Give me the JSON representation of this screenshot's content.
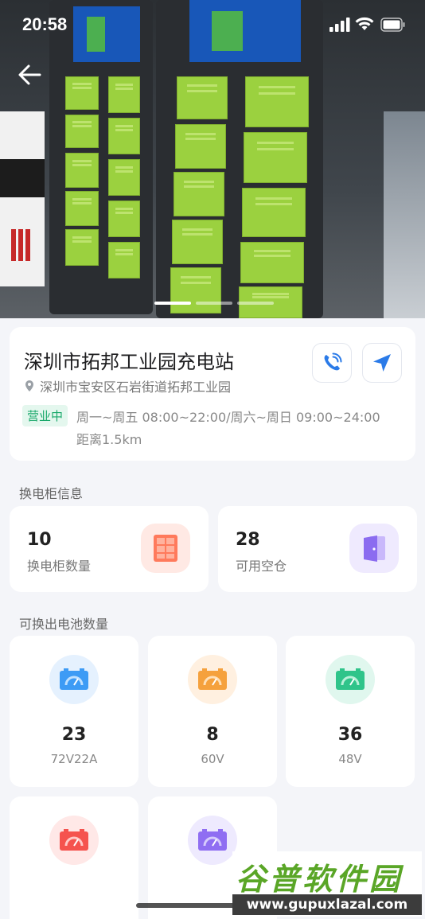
{
  "status_bar": {
    "time": "20:58"
  },
  "station": {
    "name": "深圳市拓邦工业园充电站",
    "address": "深圳市宝安区石岩街道拓邦工业园",
    "status_badge": "营业中",
    "hours": "周一~周五 08:00~22:00/周六~周日 09:00~24:00",
    "distance": "距离1.5km"
  },
  "icons": {
    "back": "back-arrow-icon",
    "call": "phone-call-icon",
    "navigate": "navigation-arrow-icon",
    "location": "location-pin-icon",
    "cabinet": "cabinet-icon",
    "door": "door-icon",
    "battery": "battery-gauge-icon"
  },
  "cabinet_section": {
    "title": "换电柜信息",
    "items": [
      {
        "value": "10",
        "label": "换电柜数量",
        "color": "#ff7a5c"
      },
      {
        "value": "28",
        "label": "可用空仓",
        "color": "#8b6cf0"
      }
    ]
  },
  "battery_section": {
    "title": "可换出电池数量",
    "items": [
      {
        "value": "23",
        "label": "72V22A",
        "color": "#3d9bf5"
      },
      {
        "value": "8",
        "label": "60V",
        "color": "#f5a13d"
      },
      {
        "value": "36",
        "label": "48V",
        "color": "#2fc48a"
      },
      {
        "value": "",
        "label": "",
        "color": "#f5534e"
      },
      {
        "value": "",
        "label": "",
        "color": "#8f6ef2"
      }
    ]
  },
  "watermark": {
    "title": "谷普软件园",
    "url": "www.gupuxlazal.com"
  },
  "carousel": {
    "slides": 3,
    "active": 0
  }
}
